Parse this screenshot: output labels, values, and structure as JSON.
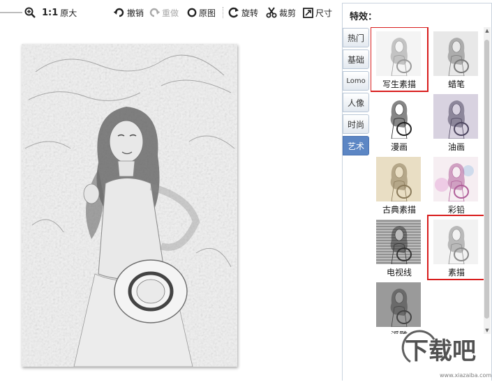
{
  "toolbar": {
    "ratio": "1:1",
    "original_size_label": "原大",
    "undo_label": "撤销",
    "redo_label": "重做",
    "original_label": "原图",
    "rotate_label": "旋转",
    "crop_label": "裁剪",
    "size_label": "尺寸"
  },
  "panel": {
    "title": "特效：",
    "categories": [
      {
        "label": "热门",
        "active": false
      },
      {
        "label": "基础",
        "active": false
      },
      {
        "label": "Lomo",
        "active": false
      },
      {
        "label": "人像",
        "active": false
      },
      {
        "label": "时尚",
        "active": false
      },
      {
        "label": "艺术",
        "active": true
      }
    ],
    "effects": [
      {
        "label": "写生素描",
        "style": "sketch",
        "selected": true
      },
      {
        "label": "蜡笔",
        "style": "crayon",
        "selected": false
      },
      {
        "label": "漫画",
        "style": "comic",
        "selected": false
      },
      {
        "label": "油画",
        "style": "oil",
        "selected": false
      },
      {
        "label": "古典素描",
        "style": "classic",
        "selected": false
      },
      {
        "label": "彩铅",
        "style": "colorpencil",
        "selected": false
      },
      {
        "label": "电视线",
        "style": "tvlines",
        "selected": false
      },
      {
        "label": "素描",
        "style": "pencil",
        "selected": true
      },
      {
        "label": "浮雕",
        "style": "emboss",
        "selected": false
      }
    ]
  },
  "watermark": {
    "text": "下载吧",
    "url": "www.xiazaiba.com"
  },
  "colors": {
    "active_tab": "#5c86c4",
    "selection_border": "#d81c1c",
    "panel_border": "#c9d3de"
  }
}
